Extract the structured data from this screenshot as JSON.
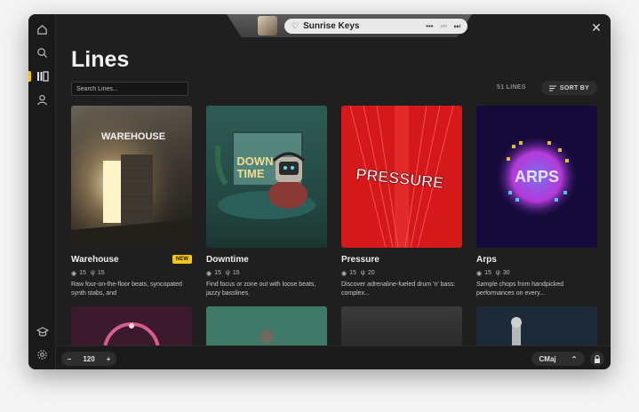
{
  "now_playing": {
    "title": "Sunrise Keys",
    "more_label": "•••",
    "prev_label": "⏮",
    "next_label": "⏭"
  },
  "page": {
    "title": "Lines",
    "search_placeholder": "Search Lines...",
    "count_label": "51 LINES",
    "sort_label": "SORT BY"
  },
  "sidebar": {
    "items": [
      {
        "name": "home",
        "icon": "home-icon"
      },
      {
        "name": "search",
        "icon": "search-icon"
      },
      {
        "name": "library",
        "icon": "library-icon",
        "active": true
      },
      {
        "name": "profile",
        "icon": "user-icon"
      },
      {
        "name": "learn",
        "icon": "graduation-cap-icon"
      },
      {
        "name": "settings",
        "icon": "gear-icon"
      }
    ]
  },
  "cards": [
    {
      "name": "Warehouse",
      "badge": "NEW",
      "packs": "15",
      "samples": "15",
      "desc": "Raw four-on-the-floor beats, syncopated synth stabs, and"
    },
    {
      "name": "Downtime",
      "badge": "",
      "packs": "15",
      "samples": "15",
      "desc": "Find focus or zone out with loose beats, jazzy basslines."
    },
    {
      "name": "Pressure",
      "badge": "",
      "packs": "15",
      "samples": "20",
      "desc": "Discover adrenaline-fueled drum 'n' bass: complex..."
    },
    {
      "name": "Arps",
      "badge": "",
      "packs": "15",
      "samples": "30",
      "desc": "Sample chops from handpicked performances on every..."
    }
  ],
  "art_text": {
    "warehouse": "WAREHOUSE",
    "downtime_line1": "DOWN",
    "downtime_line2": "TIME",
    "pressure": "PRESSURE",
    "arps": "ARPS"
  },
  "bottom": {
    "tempo_minus": "−",
    "tempo_value": "120",
    "tempo_plus": "+",
    "key_value": "CMaj",
    "key_chevron": "⌃"
  },
  "colors": {
    "accent": "#f5c518",
    "background": "#1f1f1f"
  }
}
